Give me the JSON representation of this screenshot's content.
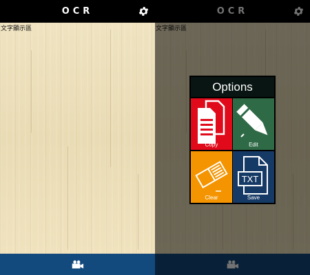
{
  "app": {
    "title": "OCR"
  },
  "ocr_text": "文字顯示區",
  "icons": {
    "settings": "gear-icon",
    "camera": "camera-icon"
  },
  "colors": {
    "topbar": "#000000",
    "bottombar": "#134a7d",
    "copy": "#e00a1a",
    "edit": "#2f6a47",
    "clear": "#f49400",
    "save": "#163a66"
  },
  "dialog": {
    "title": "Options",
    "options": [
      {
        "label": "Copy",
        "icon": "copy-icon"
      },
      {
        "label": "Edit",
        "icon": "pencil-icon"
      },
      {
        "label": "Clear",
        "icon": "eraser-icon"
      },
      {
        "label": "Save",
        "icon": "txt-file-icon",
        "icon_text": "TXT"
      }
    ]
  }
}
